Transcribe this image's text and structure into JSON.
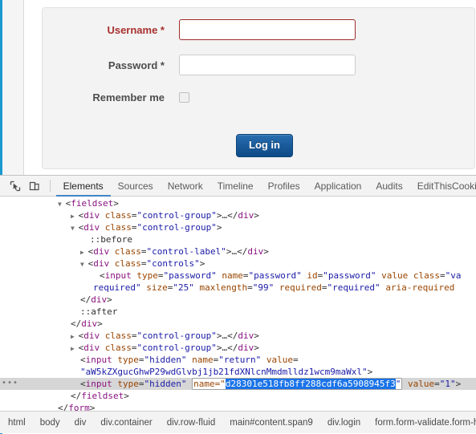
{
  "page": {
    "login_form": {
      "username_label": "Username *",
      "username_value": "",
      "password_label": "Password *",
      "password_value": "",
      "remember_label": "Remember me",
      "remember_checked": false,
      "login_button": "Log in"
    },
    "colors": {
      "invalid_border": "#9e2b2b",
      "invalid_label": "#a8312f",
      "button_blue": "#1d5e9e",
      "rail_blue": "#1b9ad0"
    }
  },
  "devtools": {
    "toolbar": {
      "inspect_icon": "inspect-cursor-icon",
      "device_icon": "device-toolbar-icon",
      "tabs": [
        {
          "label": "Elements",
          "active": true
        },
        {
          "label": "Sources",
          "active": false
        },
        {
          "label": "Network",
          "active": false
        },
        {
          "label": "Timeline",
          "active": false
        },
        {
          "label": "Profiles",
          "active": false
        },
        {
          "label": "Application",
          "active": false
        },
        {
          "label": "Audits",
          "active": false
        },
        {
          "label": "EditThisCookie",
          "active": false
        }
      ]
    },
    "dom_rows": [
      {
        "indent": 72,
        "twisty": "▼",
        "clipped_top": true,
        "parts": [
          {
            "t": "punct",
            "v": "<"
          },
          {
            "t": "tag",
            "v": "fieldset"
          },
          {
            "t": "punct",
            "v": ">"
          }
        ]
      },
      {
        "indent": 88,
        "twisty": "▶",
        "parts": [
          {
            "t": "punct",
            "v": "<"
          },
          {
            "t": "tag",
            "v": "div"
          },
          {
            "t": "punct",
            "v": " "
          },
          {
            "t": "attrn",
            "v": "class"
          },
          {
            "t": "punct",
            "v": "="
          },
          {
            "t": "attrv",
            "v": "\"control-group\""
          },
          {
            "t": "punct",
            "v": ">…</"
          },
          {
            "t": "tag",
            "v": "div"
          },
          {
            "t": "punct",
            "v": ">"
          }
        ]
      },
      {
        "indent": 88,
        "twisty": "▼",
        "parts": [
          {
            "t": "punct",
            "v": "<"
          },
          {
            "t": "tag",
            "v": "div"
          },
          {
            "t": "punct",
            "v": " "
          },
          {
            "t": "attrn",
            "v": "class"
          },
          {
            "t": "punct",
            "v": "="
          },
          {
            "t": "attrv",
            "v": "\"control-group\""
          },
          {
            "t": "punct",
            "v": ">"
          }
        ]
      },
      {
        "indent": 112,
        "twisty": "",
        "parts": [
          {
            "t": "pseudo",
            "v": "::before"
          }
        ]
      },
      {
        "indent": 100,
        "twisty": "▶",
        "parts": [
          {
            "t": "punct",
            "v": "<"
          },
          {
            "t": "tag",
            "v": "div"
          },
          {
            "t": "punct",
            "v": " "
          },
          {
            "t": "attrn",
            "v": "class"
          },
          {
            "t": "punct",
            "v": "="
          },
          {
            "t": "attrv",
            "v": "\"control-label\""
          },
          {
            "t": "punct",
            "v": ">…</"
          },
          {
            "t": "tag",
            "v": "div"
          },
          {
            "t": "punct",
            "v": ">"
          }
        ]
      },
      {
        "indent": 100,
        "twisty": "▼",
        "parts": [
          {
            "t": "punct",
            "v": "<"
          },
          {
            "t": "tag",
            "v": "div"
          },
          {
            "t": "punct",
            "v": " "
          },
          {
            "t": "attrn",
            "v": "class"
          },
          {
            "t": "punct",
            "v": "="
          },
          {
            "t": "attrv",
            "v": "\"controls\""
          },
          {
            "t": "punct",
            "v": ">"
          }
        ]
      },
      {
        "indent": 124,
        "twisty": "",
        "parts": [
          {
            "t": "punct",
            "v": "<"
          },
          {
            "t": "tag",
            "v": "input"
          },
          {
            "t": "punct",
            "v": " "
          },
          {
            "t": "attrn",
            "v": "type"
          },
          {
            "t": "punct",
            "v": "="
          },
          {
            "t": "attrv",
            "v": "\"password\""
          },
          {
            "t": "punct",
            "v": " "
          },
          {
            "t": "attrn",
            "v": "name"
          },
          {
            "t": "punct",
            "v": "="
          },
          {
            "t": "attrv",
            "v": "\"password\""
          },
          {
            "t": "punct",
            "v": " "
          },
          {
            "t": "attrn",
            "v": "id"
          },
          {
            "t": "punct",
            "v": "="
          },
          {
            "t": "attrv",
            "v": "\"password\""
          },
          {
            "t": "punct",
            "v": " "
          },
          {
            "t": "attrn",
            "v": "value"
          },
          {
            "t": "punct",
            "v": " "
          },
          {
            "t": "attrn",
            "v": "class"
          },
          {
            "t": "punct",
            "v": "="
          },
          {
            "t": "attrv",
            "v": "\"va"
          }
        ]
      },
      {
        "indent": 116,
        "twisty": "",
        "parts": [
          {
            "t": "attrv",
            "v": "required\""
          },
          {
            "t": "punct",
            "v": " "
          },
          {
            "t": "attrn",
            "v": "size"
          },
          {
            "t": "punct",
            "v": "="
          },
          {
            "t": "attrv",
            "v": "\"25\""
          },
          {
            "t": "punct",
            "v": " "
          },
          {
            "t": "attrn",
            "v": "maxlength"
          },
          {
            "t": "punct",
            "v": "="
          },
          {
            "t": "attrv",
            "v": "\"99\""
          },
          {
            "t": "punct",
            "v": " "
          },
          {
            "t": "attrn",
            "v": "required"
          },
          {
            "t": "punct",
            "v": "="
          },
          {
            "t": "attrv",
            "v": "\"required\""
          },
          {
            "t": "punct",
            "v": " "
          },
          {
            "t": "attrn",
            "v": "aria-required"
          }
        ]
      },
      {
        "indent": 100,
        "twisty": "",
        "parts": [
          {
            "t": "punct",
            "v": "</"
          },
          {
            "t": "tag",
            "v": "div"
          },
          {
            "t": "punct",
            "v": ">"
          }
        ]
      },
      {
        "indent": 100,
        "twisty": "",
        "parts": [
          {
            "t": "pseudo",
            "v": "::after"
          }
        ]
      },
      {
        "indent": 88,
        "twisty": "",
        "parts": [
          {
            "t": "punct",
            "v": "</"
          },
          {
            "t": "tag",
            "v": "div"
          },
          {
            "t": "punct",
            "v": ">"
          }
        ]
      },
      {
        "indent": 88,
        "twisty": "▶",
        "parts": [
          {
            "t": "punct",
            "v": "<"
          },
          {
            "t": "tag",
            "v": "div"
          },
          {
            "t": "punct",
            "v": " "
          },
          {
            "t": "attrn",
            "v": "class"
          },
          {
            "t": "punct",
            "v": "="
          },
          {
            "t": "attrv",
            "v": "\"control-group\""
          },
          {
            "t": "punct",
            "v": ">…</"
          },
          {
            "t": "tag",
            "v": "div"
          },
          {
            "t": "punct",
            "v": ">"
          }
        ]
      },
      {
        "indent": 88,
        "twisty": "▶",
        "parts": [
          {
            "t": "punct",
            "v": "<"
          },
          {
            "t": "tag",
            "v": "div"
          },
          {
            "t": "punct",
            "v": " "
          },
          {
            "t": "attrn",
            "v": "class"
          },
          {
            "t": "punct",
            "v": "="
          },
          {
            "t": "attrv",
            "v": "\"control-group\""
          },
          {
            "t": "punct",
            "v": ">…</"
          },
          {
            "t": "tag",
            "v": "div"
          },
          {
            "t": "punct",
            "v": ">"
          }
        ]
      },
      {
        "indent": 100,
        "twisty": "",
        "parts": [
          {
            "t": "punct",
            "v": "<"
          },
          {
            "t": "tag",
            "v": "input"
          },
          {
            "t": "punct",
            "v": " "
          },
          {
            "t": "attrn",
            "v": "type"
          },
          {
            "t": "punct",
            "v": "="
          },
          {
            "t": "attrv",
            "v": "\"hidden\""
          },
          {
            "t": "punct",
            "v": " "
          },
          {
            "t": "attrn",
            "v": "name"
          },
          {
            "t": "punct",
            "v": "="
          },
          {
            "t": "attrv",
            "v": "\"return\""
          },
          {
            "t": "punct",
            "v": " "
          },
          {
            "t": "attrn",
            "v": "value"
          },
          {
            "t": "punct",
            "v": "="
          }
        ]
      },
      {
        "indent": 100,
        "twisty": "",
        "parts": [
          {
            "t": "attrv",
            "v": "\"aW5kZXgucGhwP29wdGlvbj1jb21fdXNlcnMmdmlldz1wcm9maWxl\""
          },
          {
            "t": "punct",
            "v": ">"
          }
        ]
      }
    ],
    "selected_row": {
      "indent": 100,
      "prefix_parts": [
        {
          "t": "punct",
          "v": "<"
        },
        {
          "t": "tag",
          "v": "input"
        },
        {
          "t": "punct",
          "v": " "
        },
        {
          "t": "attrn",
          "v": "type"
        },
        {
          "t": "punct",
          "v": "="
        },
        {
          "t": "attrv",
          "v": "\"hidden\""
        },
        {
          "t": "punct",
          "v": " "
        }
      ],
      "edit_attr_name": "name=\"",
      "edit_selected_value": "d28301e518fb8ff288cdf6a5908945f3",
      "edit_attr_close": "\"",
      "suffix_parts": [
        {
          "t": "punct",
          "v": " "
        },
        {
          "t": "attrn",
          "v": "value"
        },
        {
          "t": "punct",
          "v": "="
        },
        {
          "t": "attrv",
          "v": "\"1\""
        },
        {
          "t": "punct",
          "v": ">"
        }
      ]
    },
    "dom_rows_after": [
      {
        "indent": 88,
        "twisty": "",
        "parts": [
          {
            "t": "punct",
            "v": "</"
          },
          {
            "t": "tag",
            "v": "fieldset"
          },
          {
            "t": "punct",
            "v": ">"
          }
        ]
      },
      {
        "indent": 72,
        "twisty": "",
        "parts": [
          {
            "t": "punct",
            "v": "</"
          },
          {
            "t": "tag",
            "v": "form"
          },
          {
            "t": "punct",
            "v": ">"
          }
        ]
      },
      {
        "indent": 60,
        "twisty": "",
        "clipped_bottom": true,
        "parts": [
          {
            "t": "punct",
            "v": "</"
          },
          {
            "t": "tag",
            "v": "div"
          },
          {
            "t": "punct",
            "v": ">"
          }
        ]
      }
    ],
    "breadcrumbs": [
      "html",
      "body",
      "div",
      "div.container",
      "div.row-fluid",
      "main#content.span9",
      "div.login",
      "form.form-validate.form-horizont"
    ]
  }
}
